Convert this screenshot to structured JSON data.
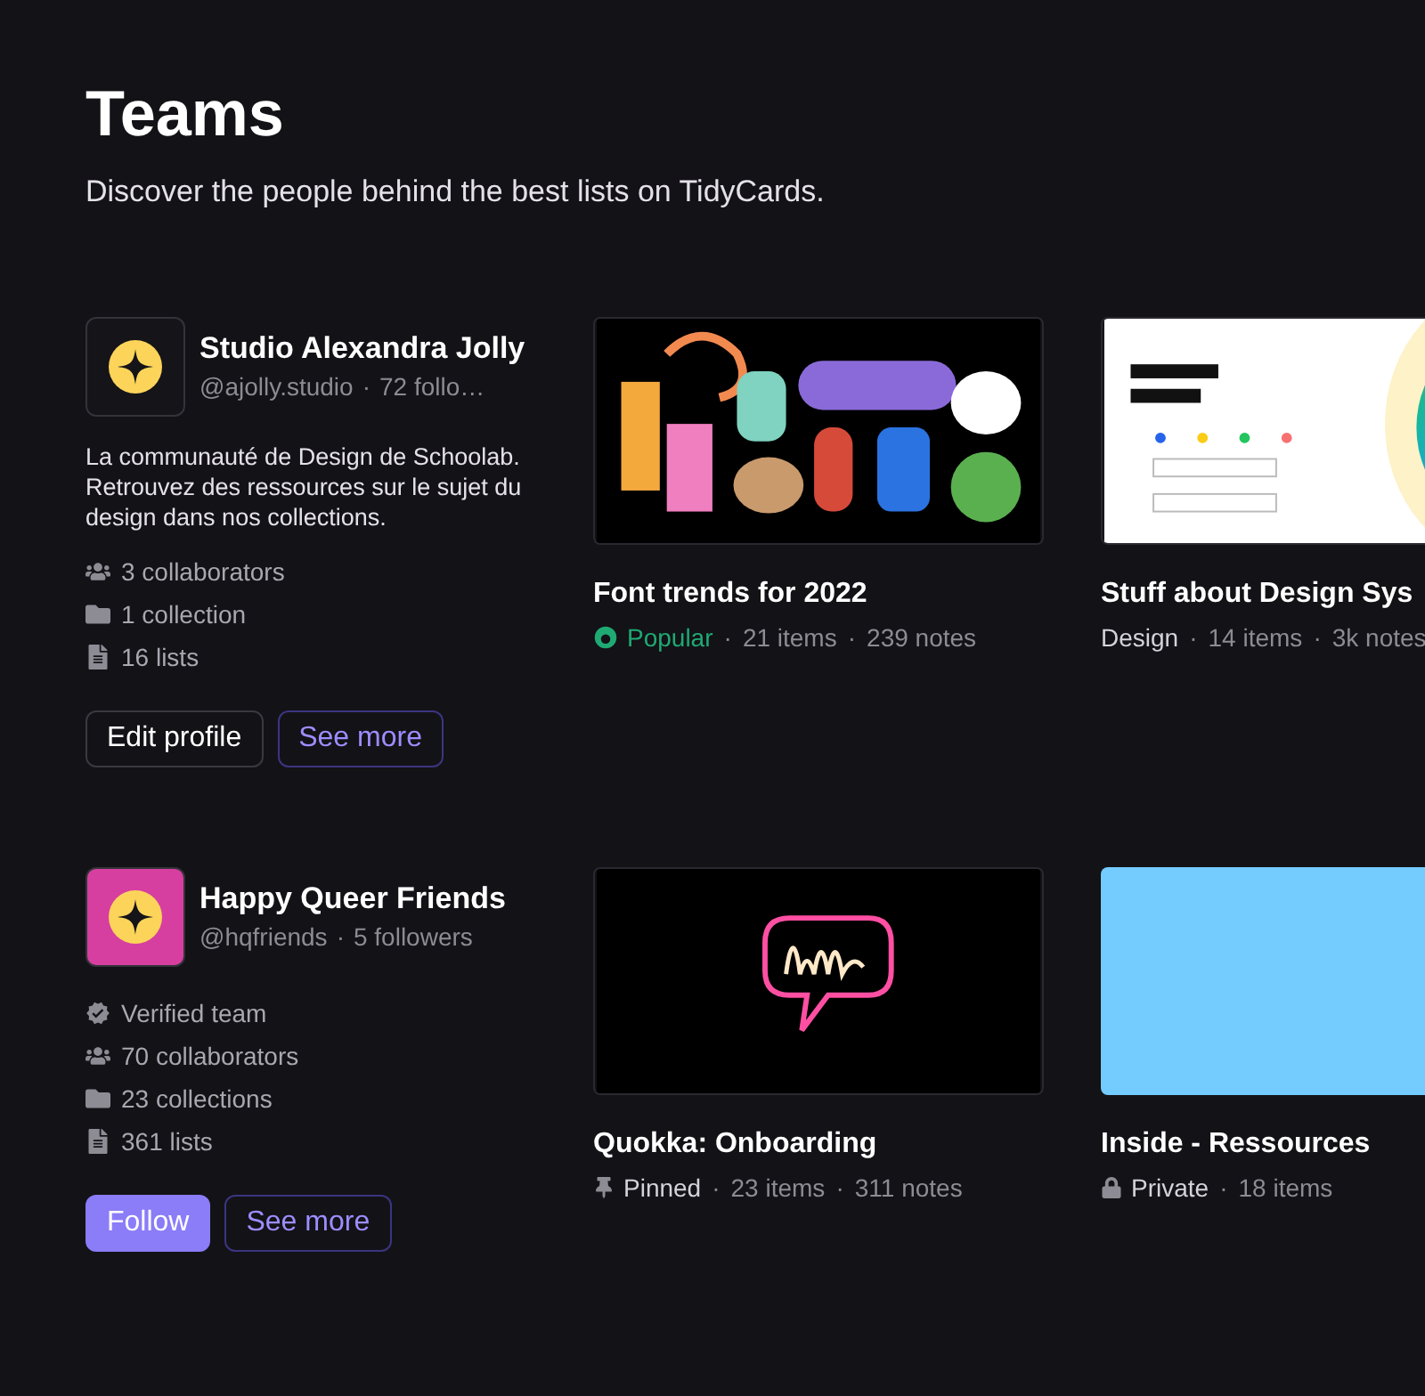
{
  "header": {
    "title": "Teams",
    "subtitle": "Discover the people behind the best lists on TidyCards."
  },
  "teams": [
    {
      "name": "Studio Alexandra Jolly",
      "handle": "@ajolly.studio",
      "separator": "·",
      "followers": "72 follo…",
      "color": "#151419",
      "description": "La communauté de Design de Schoolab. Retrouvez des ressources sur le sujet du design dans nos collections.",
      "stats": [
        {
          "kind": "collaborators",
          "text": "3 collaborators"
        },
        {
          "kind": "collections",
          "text": "1 collection"
        },
        {
          "kind": "lists",
          "text": "16 lists"
        }
      ],
      "buttons": [
        {
          "kind": "secondary",
          "label": "Edit profile"
        },
        {
          "kind": "outline",
          "label": "See more"
        }
      ],
      "lists": [
        {
          "thumbnail": {
            "kind": "picture"
          },
          "title": "Font trends for 2022",
          "tag": {
            "kind": "popular",
            "label": "Popular"
          },
          "meta": [
            {
              "separator": "·",
              "text": "21 items"
            },
            {
              "separator": "·",
              "text": "239 notes"
            }
          ]
        },
        {
          "thumbnail": {
            "kind": "picture"
          },
          "title": "Stuff about Design Sys",
          "tag": {
            "kind": "plain",
            "label": "Design"
          },
          "meta": [
            {
              "separator": "·",
              "text": "14 items"
            },
            {
              "separator": "·",
              "text": "3k notes"
            }
          ]
        }
      ]
    },
    {
      "name": "Happy Queer Friends",
      "handle": "@hqfriends",
      "separator": "·",
      "followers": "5 followers",
      "color": "#d63fa0",
      "stats": [
        {
          "kind": "verified",
          "text": "Verified team"
        },
        {
          "kind": "collaborators",
          "text": "70 collaborators"
        },
        {
          "kind": "collections",
          "text": "23 collections"
        },
        {
          "kind": "lists",
          "text": "361 lists"
        }
      ],
      "buttons": [
        {
          "kind": "primary",
          "label": "Follow"
        },
        {
          "kind": "outline",
          "label": "See more"
        }
      ],
      "lists": [
        {
          "thumbnail": {
            "kind": "picture"
          },
          "title": "Quokka: Onboarding",
          "tag": {
            "kind": "pinned",
            "label": "Pinned"
          },
          "meta": [
            {
              "separator": "·",
              "text": "23 items"
            },
            {
              "separator": "·",
              "text": "311 notes"
            }
          ]
        },
        {
          "thumbnail": {
            "kind": "color",
            "color": "#74cbfd"
          },
          "title": "Inside - Ressources",
          "tag": {
            "kind": "private",
            "label": "Private"
          },
          "meta": [
            {
              "separator": "·",
              "text": "18 items"
            }
          ]
        }
      ]
    }
  ]
}
